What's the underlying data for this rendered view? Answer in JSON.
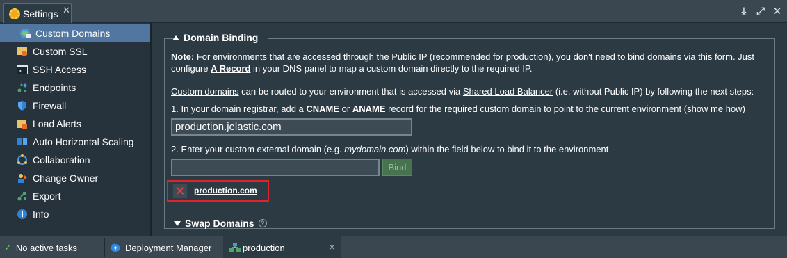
{
  "window": {
    "tab_title": "Settings",
    "controls": [
      "download-icon",
      "expand-icon",
      "close-icon"
    ]
  },
  "sidebar": {
    "items": [
      {
        "label": "Custom Domains",
        "icon": "custom-domains-icon",
        "active": true
      },
      {
        "label": "Custom SSL",
        "icon": "ssl-certificate-icon"
      },
      {
        "label": "SSH Access",
        "icon": "terminal-icon"
      },
      {
        "label": "Endpoints",
        "icon": "endpoints-icon"
      },
      {
        "label": "Firewall",
        "icon": "shield-icon"
      },
      {
        "label": "Load Alerts",
        "icon": "load-alerts-icon"
      },
      {
        "label": "Auto Horizontal Scaling",
        "icon": "scaling-icon"
      },
      {
        "label": "Collaboration",
        "icon": "collaboration-icon"
      },
      {
        "label": "Change Owner",
        "icon": "change-owner-icon"
      },
      {
        "label": "Export",
        "icon": "export-icon"
      },
      {
        "label": "Info",
        "icon": "info-icon"
      }
    ]
  },
  "domain_binding": {
    "title": "Domain Binding",
    "note_label": "Note:",
    "note_1a": " For environments that are accessed through the ",
    "note_public_ip": "Public IP",
    "note_1b": " (recommended for production), you don't need to bind domains via this form. Just",
    "note_2a": "configure ",
    "note_a_record": "A Record",
    "note_2b": " in your DNS panel to map a custom domain directly to the required IP.",
    "routing_custom_domains": "Custom domains",
    "routing_a": " can be routed to your environment that is accessed via ",
    "routing_slb": "Shared Load Balancer",
    "routing_b": " (i.e. without Public IP) by following the next steps:",
    "step1_a": "1. In your domain registrar, add a ",
    "step1_cname": "CNAME",
    "step1_or": " or ",
    "step1_aname": "ANAME",
    "step1_b": " record for the required custom domain to point to the current environment (",
    "step1_link": "show me how",
    "step1_c": ")",
    "env_domain_value": "production.jelastic.com",
    "step2_a": "2. Enter your custom external domain (e.g. ",
    "step2_example": "mydomain.com",
    "step2_b": ") within the field below to bind it to the environment",
    "domain_input_value": "",
    "bind_label": "Bind",
    "bound_domain": "production.com"
  },
  "swap_domains": {
    "title": "Swap Domains"
  },
  "taskbar": {
    "status": "No active tasks",
    "deployment_manager": "Deployment Manager",
    "active_tab": "production"
  },
  "colors": {
    "accent": "#5176a0",
    "highlight_border": "#e0222b",
    "bind_button": "#47744f"
  }
}
